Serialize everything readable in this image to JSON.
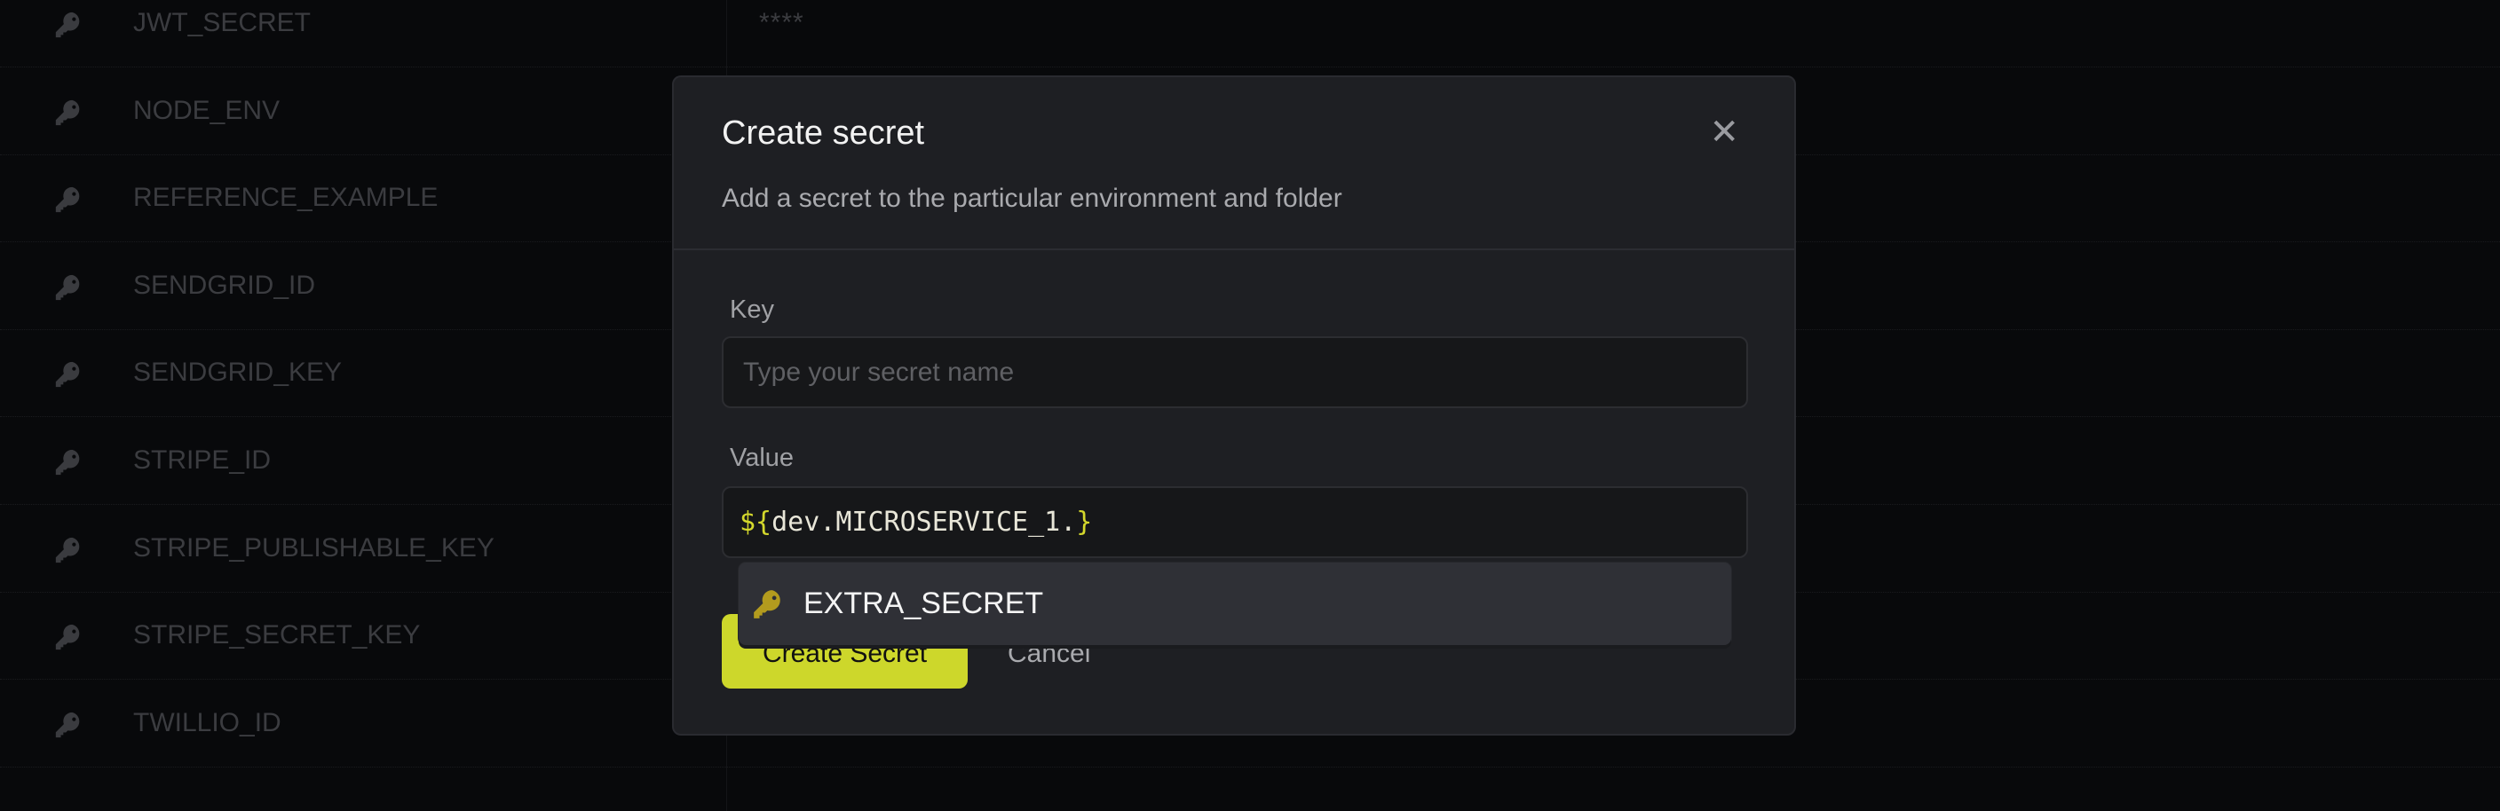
{
  "secrets_list": [
    {
      "name": "JWT_SECRET",
      "value": "****"
    },
    {
      "name": "NODE_ENV",
      "value": ""
    },
    {
      "name": "REFERENCE_EXAMPLE",
      "value": ""
    },
    {
      "name": "SENDGRID_ID",
      "value": ""
    },
    {
      "name": "SENDGRID_KEY",
      "value": ""
    },
    {
      "name": "STRIPE_ID",
      "value": ""
    },
    {
      "name": "STRIPE_PUBLISHABLE_KEY",
      "value": ""
    },
    {
      "name": "STRIPE_SECRET_KEY",
      "value": ""
    },
    {
      "name": "TWILLIO_ID",
      "value": "*******"
    }
  ],
  "modal": {
    "title": "Create secret",
    "close_icon": "close-icon",
    "subtitle": "Add a secret to the particular environment and folder",
    "key_label": "Key",
    "key_placeholder": "Type your secret name",
    "value_label": "Value",
    "value_prefix": "${",
    "value_body": "dev.MICROSERVICE_1.",
    "value_suffix": "}",
    "autocomplete": [
      {
        "icon": "key-icon",
        "label": "EXTRA_SECRET"
      }
    ],
    "submit_label": "Create Secret",
    "cancel_label": "Cancel"
  },
  "colors": {
    "accent": "#cdd72b",
    "background": "#08090b",
    "modal": "#1e1f23",
    "key_icon_highlight": "#b39b1e"
  }
}
